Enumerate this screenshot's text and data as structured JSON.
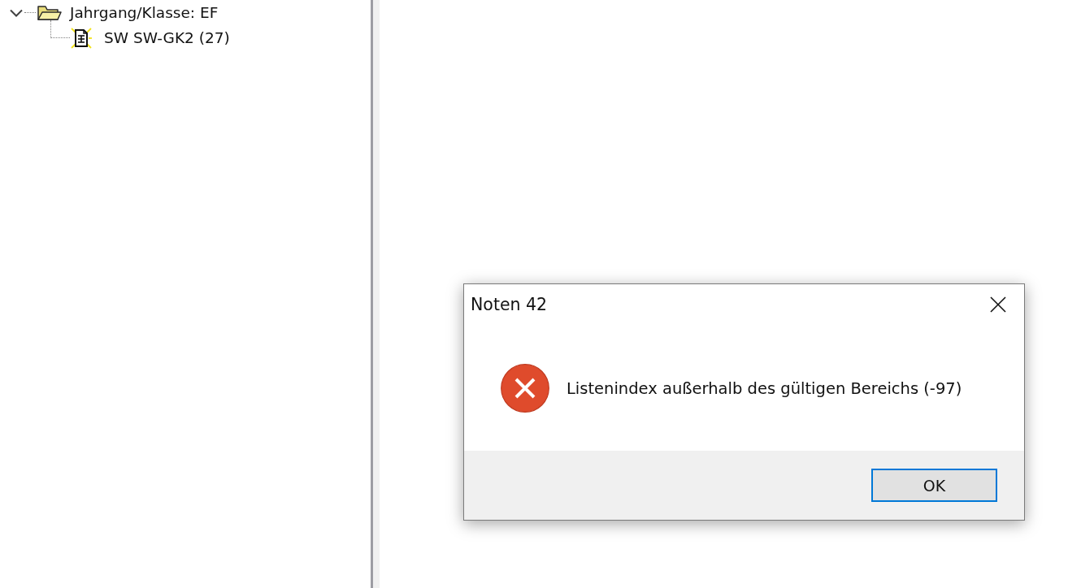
{
  "tree": [
    {
      "label": "Jahrgang/Klasse: EF",
      "kind": "folder",
      "expanded": true,
      "children": [
        {
          "label": "SW SW-GK2 (27)",
          "kind": "document"
        }
      ]
    }
  ],
  "dialog": {
    "title": "Noten 42",
    "message": "Listenindex außerhalb des gültigen Bereichs (-97)",
    "buttons": [
      {
        "label": "OK",
        "default": true
      }
    ]
  }
}
